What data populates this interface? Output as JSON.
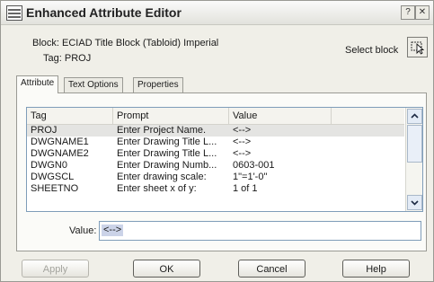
{
  "window": {
    "title": "Enhanced Attribute Editor",
    "help_btn": "?",
    "close_btn": "✕"
  },
  "header": {
    "block_label": "Block:",
    "block_value": "ECIAD Title Block (Tabloid) Imperial",
    "tag_label": "Tag:",
    "tag_value": "PROJ",
    "select_block_label": "Select block"
  },
  "tabs": [
    {
      "label": "Attribute",
      "active": true
    },
    {
      "label": "Text Options",
      "active": false
    },
    {
      "label": "Properties",
      "active": false
    }
  ],
  "table": {
    "columns": [
      "Tag",
      "Prompt",
      "Value"
    ],
    "rows": [
      {
        "tag": "PROJ",
        "prompt": "Enter Project Name.",
        "value": "<-->"
      },
      {
        "tag": "DWGNAME1",
        "prompt": "Enter Drawing Title L...",
        "value": "<-->"
      },
      {
        "tag": "DWGNAME2",
        "prompt": "Enter Drawing Title L...",
        "value": "<-->"
      },
      {
        "tag": "DWGN0",
        "prompt": "Enter Drawing Numb...",
        "value": "0603-001"
      },
      {
        "tag": "DWGSCL",
        "prompt": "Enter drawing scale:",
        "value": "1\"=1'-0\""
      },
      {
        "tag": "SHEETNO",
        "prompt": "Enter sheet x of y:",
        "value": "1 of 1"
      }
    ],
    "selected_index": 0
  },
  "value_field": {
    "label": "Value:",
    "value": "<-->"
  },
  "buttons": {
    "apply": "Apply",
    "ok": "OK",
    "cancel": "Cancel",
    "help": "Help"
  }
}
